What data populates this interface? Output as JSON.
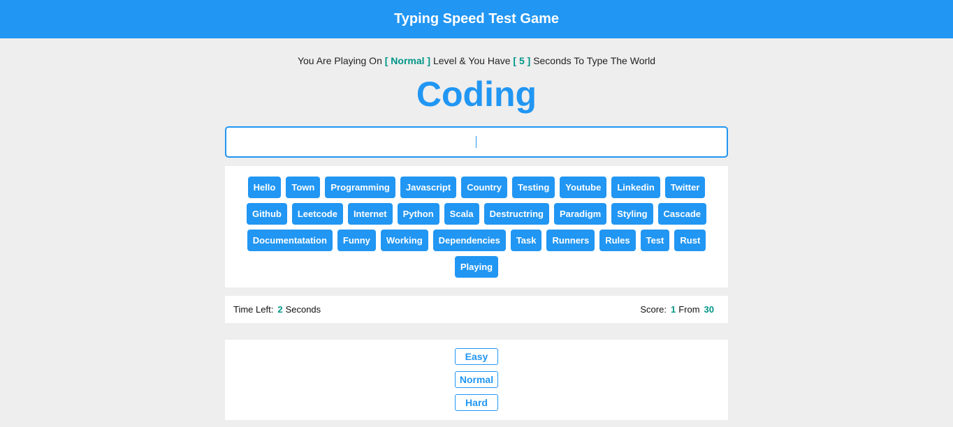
{
  "header": {
    "title": "Typing Speed Test Game"
  },
  "message": {
    "prefix": "You Are Playing On",
    "level": "[ Normal ]",
    "middle": "Level & You Have",
    "seconds": "[ 5 ]",
    "suffix": "Seconds To Type The World"
  },
  "current_word": "Coding",
  "input": {
    "value": "",
    "placeholder": ""
  },
  "upcoming_words": [
    "Hello",
    "Town",
    "Programming",
    "Javascript",
    "Country",
    "Testing",
    "Youtube",
    "Linkedin",
    "Twitter",
    "Github",
    "Leetcode",
    "Internet",
    "Python",
    "Scala",
    "Destructring",
    "Paradigm",
    "Styling",
    "Cascade",
    "Documentatation",
    "Funny",
    "Working",
    "Dependencies",
    "Task",
    "Runners",
    "Rules",
    "Test",
    "Rust",
    "Playing"
  ],
  "control": {
    "time_label": "Time Left:",
    "time_value": "2",
    "time_unit": "Seconds",
    "score_label": "Score:",
    "score_value": "1",
    "score_from": "From",
    "score_total": "30"
  },
  "levels": [
    "Easy",
    "Normal",
    "Hard"
  ],
  "colors": {
    "primary": "#2196f3",
    "accent": "#009688",
    "background": "#eeeeee"
  }
}
